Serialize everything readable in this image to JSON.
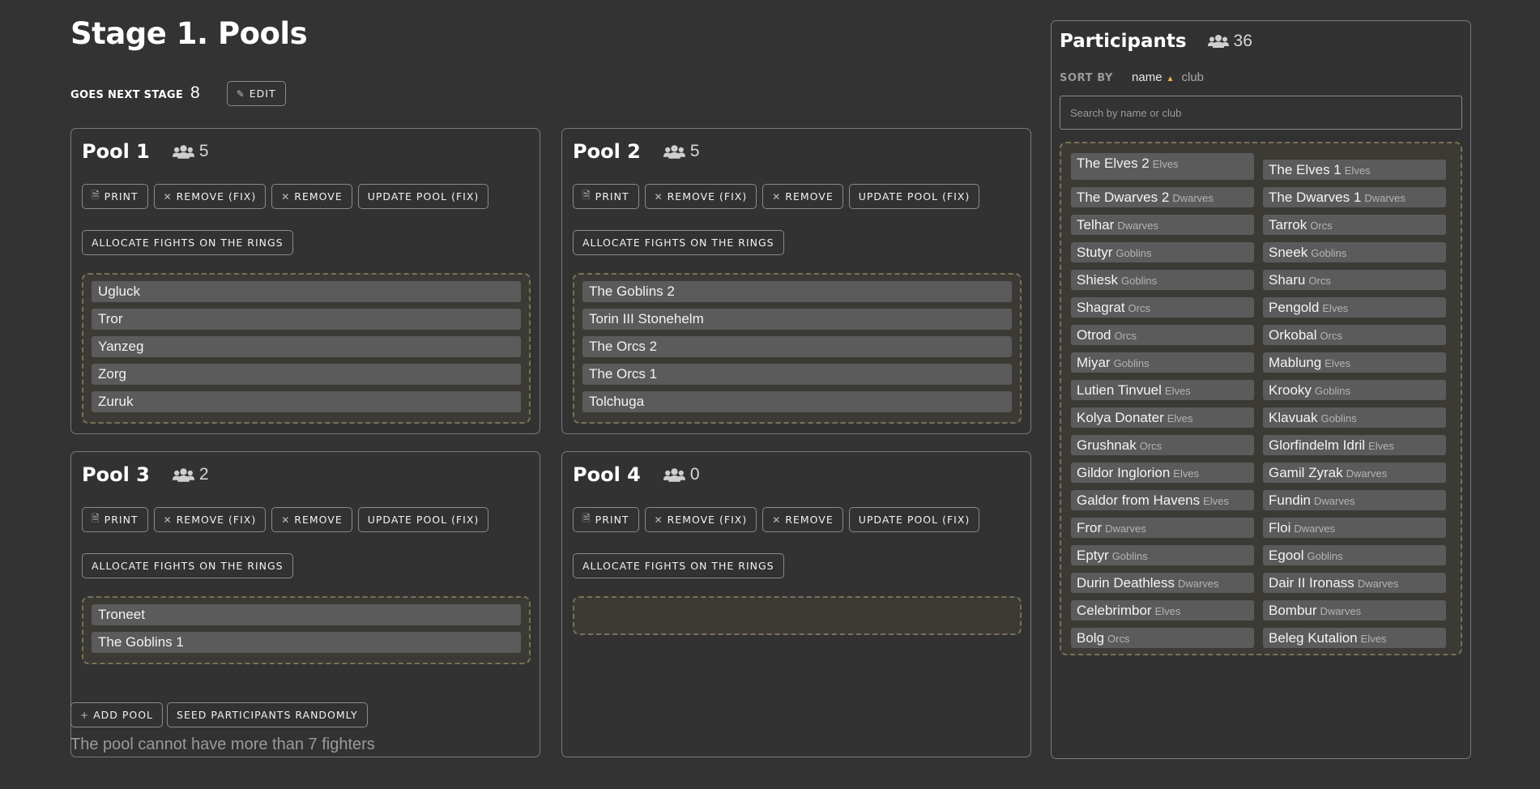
{
  "page": {
    "title": "Stage 1. Pools",
    "goes_next_label": "GOES NEXT STAGE",
    "goes_next_value": "8",
    "edit_label": "EDIT"
  },
  "pool_buttons": {
    "print": "PRINT",
    "remove_fix": "REMOVE (FIX)",
    "remove": "REMOVE",
    "update": "UPDATE POOL (FIX)",
    "allocate": "ALLOCATE FIGHTS ON THE RINGS"
  },
  "pools": [
    {
      "title": "Pool 1",
      "count": "5",
      "members": [
        "Ugluck",
        "Tror",
        "Yanzeg",
        "Zorg",
        "Zuruk"
      ]
    },
    {
      "title": "Pool 2",
      "count": "5",
      "members": [
        "The Goblins 2",
        "Torin III Stonehelm",
        "The Orcs 2",
        "The Orcs 1",
        "Tolchuga"
      ]
    },
    {
      "title": "Pool 3",
      "count": "2",
      "members": [
        "Troneet",
        "The Goblins 1"
      ]
    },
    {
      "title": "Pool 4",
      "count": "0",
      "members": []
    }
  ],
  "bottom": {
    "add_pool": "ADD POOL",
    "seed": "SEED PARTICIPANTS RANDOMLY",
    "warning": "The pool cannot have more than 7 fighters"
  },
  "participants": {
    "title": "Participants",
    "count": "36",
    "sort_label": "SORT BY",
    "sort_name": "name",
    "sort_club": "club",
    "search_placeholder": "Search by name or club",
    "left_column": [
      {
        "name": "The Elves 2",
        "club": "Elves"
      },
      {
        "name": "The Dwarves 2",
        "club": "Dwarves"
      },
      {
        "name": "Telhar",
        "club": "Dwarves"
      },
      {
        "name": "Stutyr",
        "club": "Goblins"
      },
      {
        "name": "Shiesk",
        "club": "Goblins"
      },
      {
        "name": "Shagrat",
        "club": "Orcs"
      },
      {
        "name": "Otrod",
        "club": "Orcs"
      },
      {
        "name": "Miyar",
        "club": "Goblins"
      },
      {
        "name": "Lutien Tinvuel",
        "club": "Elves"
      },
      {
        "name": "Kolya Donater",
        "club": "Elves"
      },
      {
        "name": "Grushnak",
        "club": "Orcs"
      },
      {
        "name": "Gildor Inglorion",
        "club": "Elves"
      },
      {
        "name": "Galdor from Havens",
        "club": "Elves"
      },
      {
        "name": "Fror",
        "club": "Dwarves"
      },
      {
        "name": "Eptyr",
        "club": "Goblins"
      },
      {
        "name": "Durin Deathless",
        "club": "Dwarves"
      },
      {
        "name": "Celebrimbor",
        "club": "Elves"
      },
      {
        "name": "Bolg",
        "club": "Orcs"
      }
    ],
    "right_column": [
      {
        "name": "The Elves 1",
        "club": "Elves"
      },
      {
        "name": "The Dwarves 1",
        "club": "Dwarves"
      },
      {
        "name": "Tarrok",
        "club": "Orcs"
      },
      {
        "name": "Sneek",
        "club": "Goblins"
      },
      {
        "name": "Sharu",
        "club": "Orcs"
      },
      {
        "name": "Pengold",
        "club": "Elves"
      },
      {
        "name": "Orkobal",
        "club": "Orcs"
      },
      {
        "name": "Mablung",
        "club": "Elves"
      },
      {
        "name": "Krooky",
        "club": "Goblins"
      },
      {
        "name": "Klavuak",
        "club": "Goblins"
      },
      {
        "name": "Glorfindelm Idril",
        "club": "Elves"
      },
      {
        "name": "Gamil Zyrak",
        "club": "Dwarves"
      },
      {
        "name": "Fundin",
        "club": "Dwarves"
      },
      {
        "name": "Floi",
        "club": "Dwarves"
      },
      {
        "name": "Egool",
        "club": "Goblins"
      },
      {
        "name": "Dair II Ironass",
        "club": "Dwarves"
      },
      {
        "name": "Bombur",
        "club": "Dwarves"
      },
      {
        "name": "Beleg Kutalion",
        "club": "Elves"
      }
    ]
  }
}
